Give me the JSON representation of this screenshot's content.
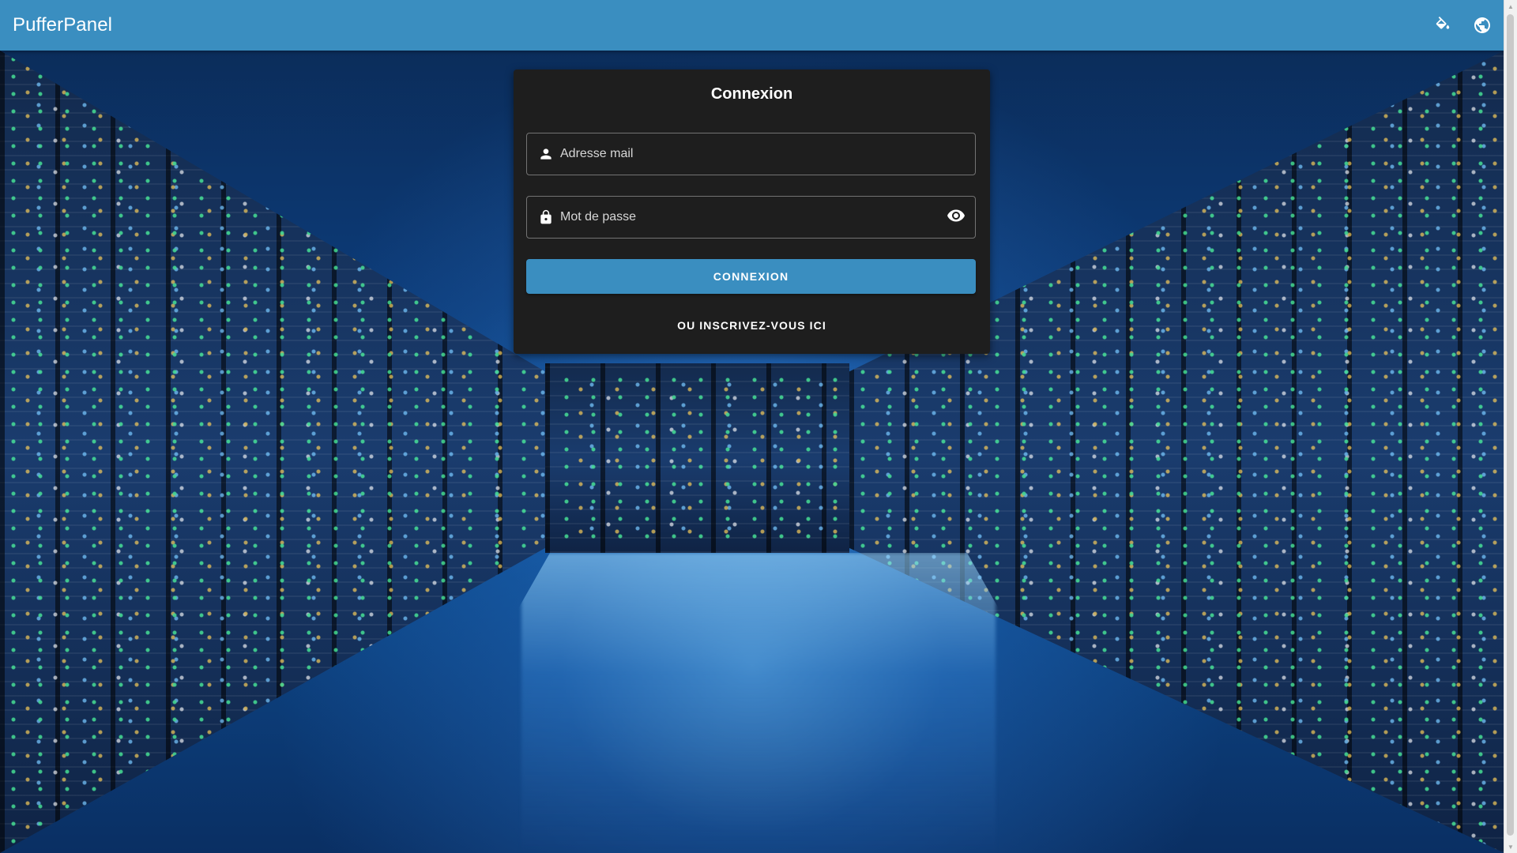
{
  "app": {
    "title": "PufferPanel"
  },
  "topbar": {
    "actions": [
      {
        "icon": "paint-bucket-icon"
      },
      {
        "icon": "globe-icon"
      }
    ]
  },
  "login": {
    "title": "Connexion",
    "email_placeholder": "Adresse mail",
    "email_value": "",
    "password_placeholder": "Mot de passe",
    "password_value": "",
    "submit_label": "CONNEXION",
    "register_label": "OU INSCRIVEZ-VOUS ICI"
  },
  "colors": {
    "primary": "#3a8ec0",
    "card": "#1e1e1e"
  }
}
